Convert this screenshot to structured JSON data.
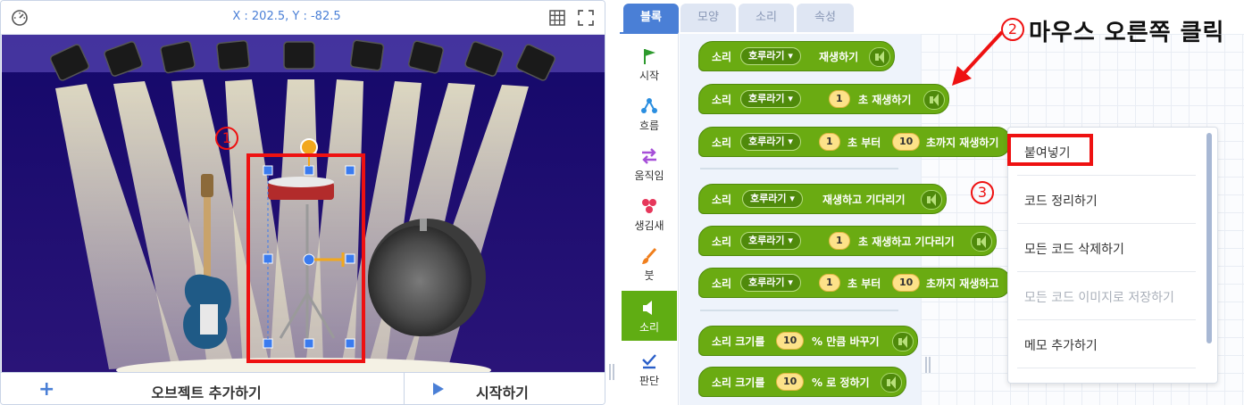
{
  "stage": {
    "coordinates": "X : 202.5, Y : -82.5",
    "add_object_label": "오브젝트 추가하기",
    "start_label": "시작하기"
  },
  "editor": {
    "tabs": [
      {
        "label": "블록",
        "active": true
      },
      {
        "label": "모양",
        "active": false
      },
      {
        "label": "소리",
        "active": false
      },
      {
        "label": "속성",
        "active": false
      }
    ],
    "categories": [
      {
        "label": "시작",
        "icon": "flag-icon"
      },
      {
        "label": "흐름",
        "icon": "flow-icon"
      },
      {
        "label": "움직임",
        "icon": "move-arrows-icon"
      },
      {
        "label": "생김새",
        "icon": "looks-shapes-icon"
      },
      {
        "label": "붓",
        "icon": "brush-icon"
      },
      {
        "label": "소리",
        "icon": "speaker-icon",
        "active": true
      },
      {
        "label": "판단",
        "icon": "check-icon"
      }
    ],
    "blocks": {
      "b1": {
        "sound": "소리",
        "dropdown": "호루라기",
        "text": "재생하기"
      },
      "b2": {
        "sound": "소리",
        "dropdown": "호루라기",
        "num": "1",
        "text": "초 재생하기"
      },
      "b3": {
        "sound": "소리",
        "dropdown": "호루라기",
        "num": "1",
        "text1": "초 부터",
        "num2": "10",
        "text2": "초까지 재생하기"
      },
      "b4": {
        "sound": "소리",
        "dropdown": "호루라기",
        "text": "재생하고 기다리기"
      },
      "b5": {
        "sound": "소리",
        "dropdown": "호루라기",
        "num": "1",
        "text": "초 재생하고 기다리기"
      },
      "b6": {
        "sound": "소리",
        "dropdown": "호루라기",
        "num": "1",
        "text1": "초 부터",
        "num2": "10",
        "text2": "초까지 재생하고"
      },
      "b7": {
        "text1": "소리 크기를",
        "num": "10",
        "text2": "% 만큼 바꾸기"
      },
      "b8": {
        "text1": "소리 크기를",
        "num": "10",
        "text2": "% 로 정하기"
      }
    },
    "dropdown_arrow": "▾"
  },
  "context_menu": {
    "items": [
      {
        "label": "붙여넣기",
        "enabled": true
      },
      {
        "label": "코드 정리하기",
        "enabled": true
      },
      {
        "label": "모든 코드 삭제하기",
        "enabled": true
      },
      {
        "label": "모든 코드 이미지로 저장하기",
        "enabled": false
      },
      {
        "label": "메모 추가하기",
        "enabled": true
      }
    ]
  },
  "annotations": {
    "step1": "1",
    "step2": "2",
    "step2_text": "마우스 오른쪽 클릭",
    "step3": "3"
  },
  "colors": {
    "accent": "#4a7fd6",
    "sound_block": "#6aab12",
    "highlight": "#ee1111",
    "stage_bg": "#1f0f6b"
  }
}
